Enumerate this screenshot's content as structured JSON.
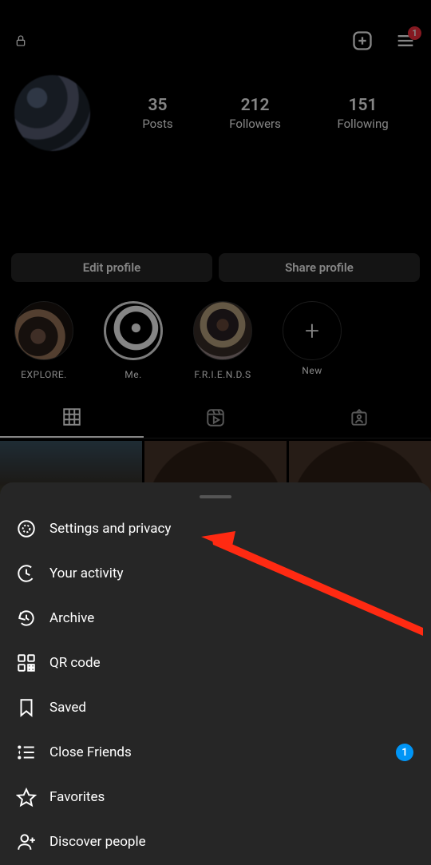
{
  "topbar": {
    "username": "",
    "menu_badge": "1"
  },
  "stats": {
    "posts": {
      "count": "35",
      "label": "Posts"
    },
    "followers": {
      "count": "212",
      "label": "Followers"
    },
    "following": {
      "count": "151",
      "label": "Following"
    }
  },
  "buttons": {
    "edit": "Edit profile",
    "share": "Share profile"
  },
  "highlights": [
    {
      "label": "EXPLORE."
    },
    {
      "label": "Me."
    },
    {
      "label": "F.R.I.E.N.D.S"
    },
    {
      "label": "New",
      "plus": "+"
    }
  ],
  "menu": {
    "settings": {
      "label": "Settings and privacy"
    },
    "activity": {
      "label": "Your activity"
    },
    "archive": {
      "label": "Archive"
    },
    "qr": {
      "label": "QR code"
    },
    "saved": {
      "label": "Saved"
    },
    "close_friends": {
      "label": "Close Friends",
      "badge": "1"
    },
    "favorites": {
      "label": "Favorites"
    },
    "discover": {
      "label": "Discover people"
    }
  },
  "colors": {
    "accent": "#0095f6",
    "notif": "#ff3040",
    "sheet": "#262626",
    "arrow": "#ff2a12"
  }
}
